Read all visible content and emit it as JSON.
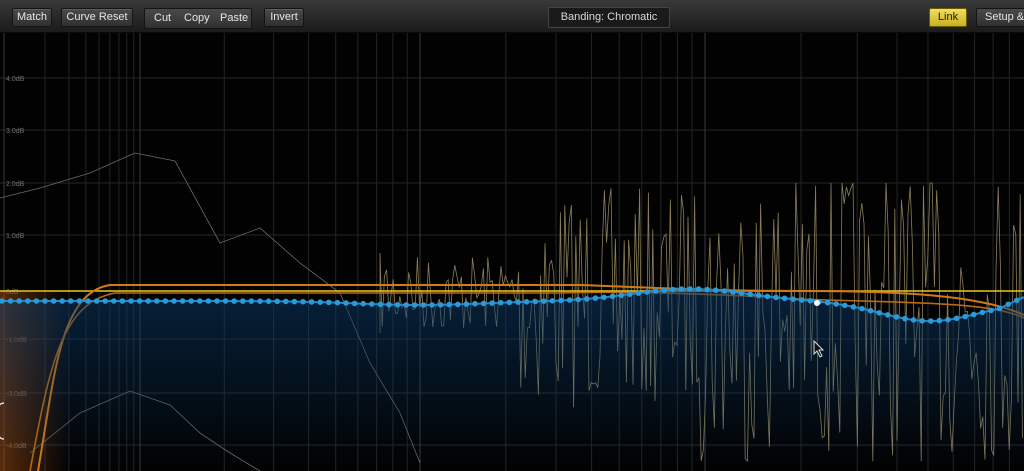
{
  "toolbar": {
    "match": "Match",
    "curve_reset": "Curve Reset",
    "cut": "Cut",
    "copy": "Copy",
    "paste": "Paste",
    "invert": "Invert",
    "banding": "Banding: Chromatic",
    "link": "Link",
    "setup": "Setup &"
  },
  "graph": {
    "db_labels": [
      "4.0dB",
      "3.0dB",
      "2.0dB",
      "1.0dB",
      "0dB",
      "-1.0dB",
      "-3.0dB",
      "-4.0dB"
    ]
  },
  "colors": {
    "reference_line": "#e8c820",
    "orange_curve": "#d07a18",
    "eq_curve": "#1e88c8",
    "spectrum": "#8a7e5a",
    "grid": "#2a2a2a"
  }
}
